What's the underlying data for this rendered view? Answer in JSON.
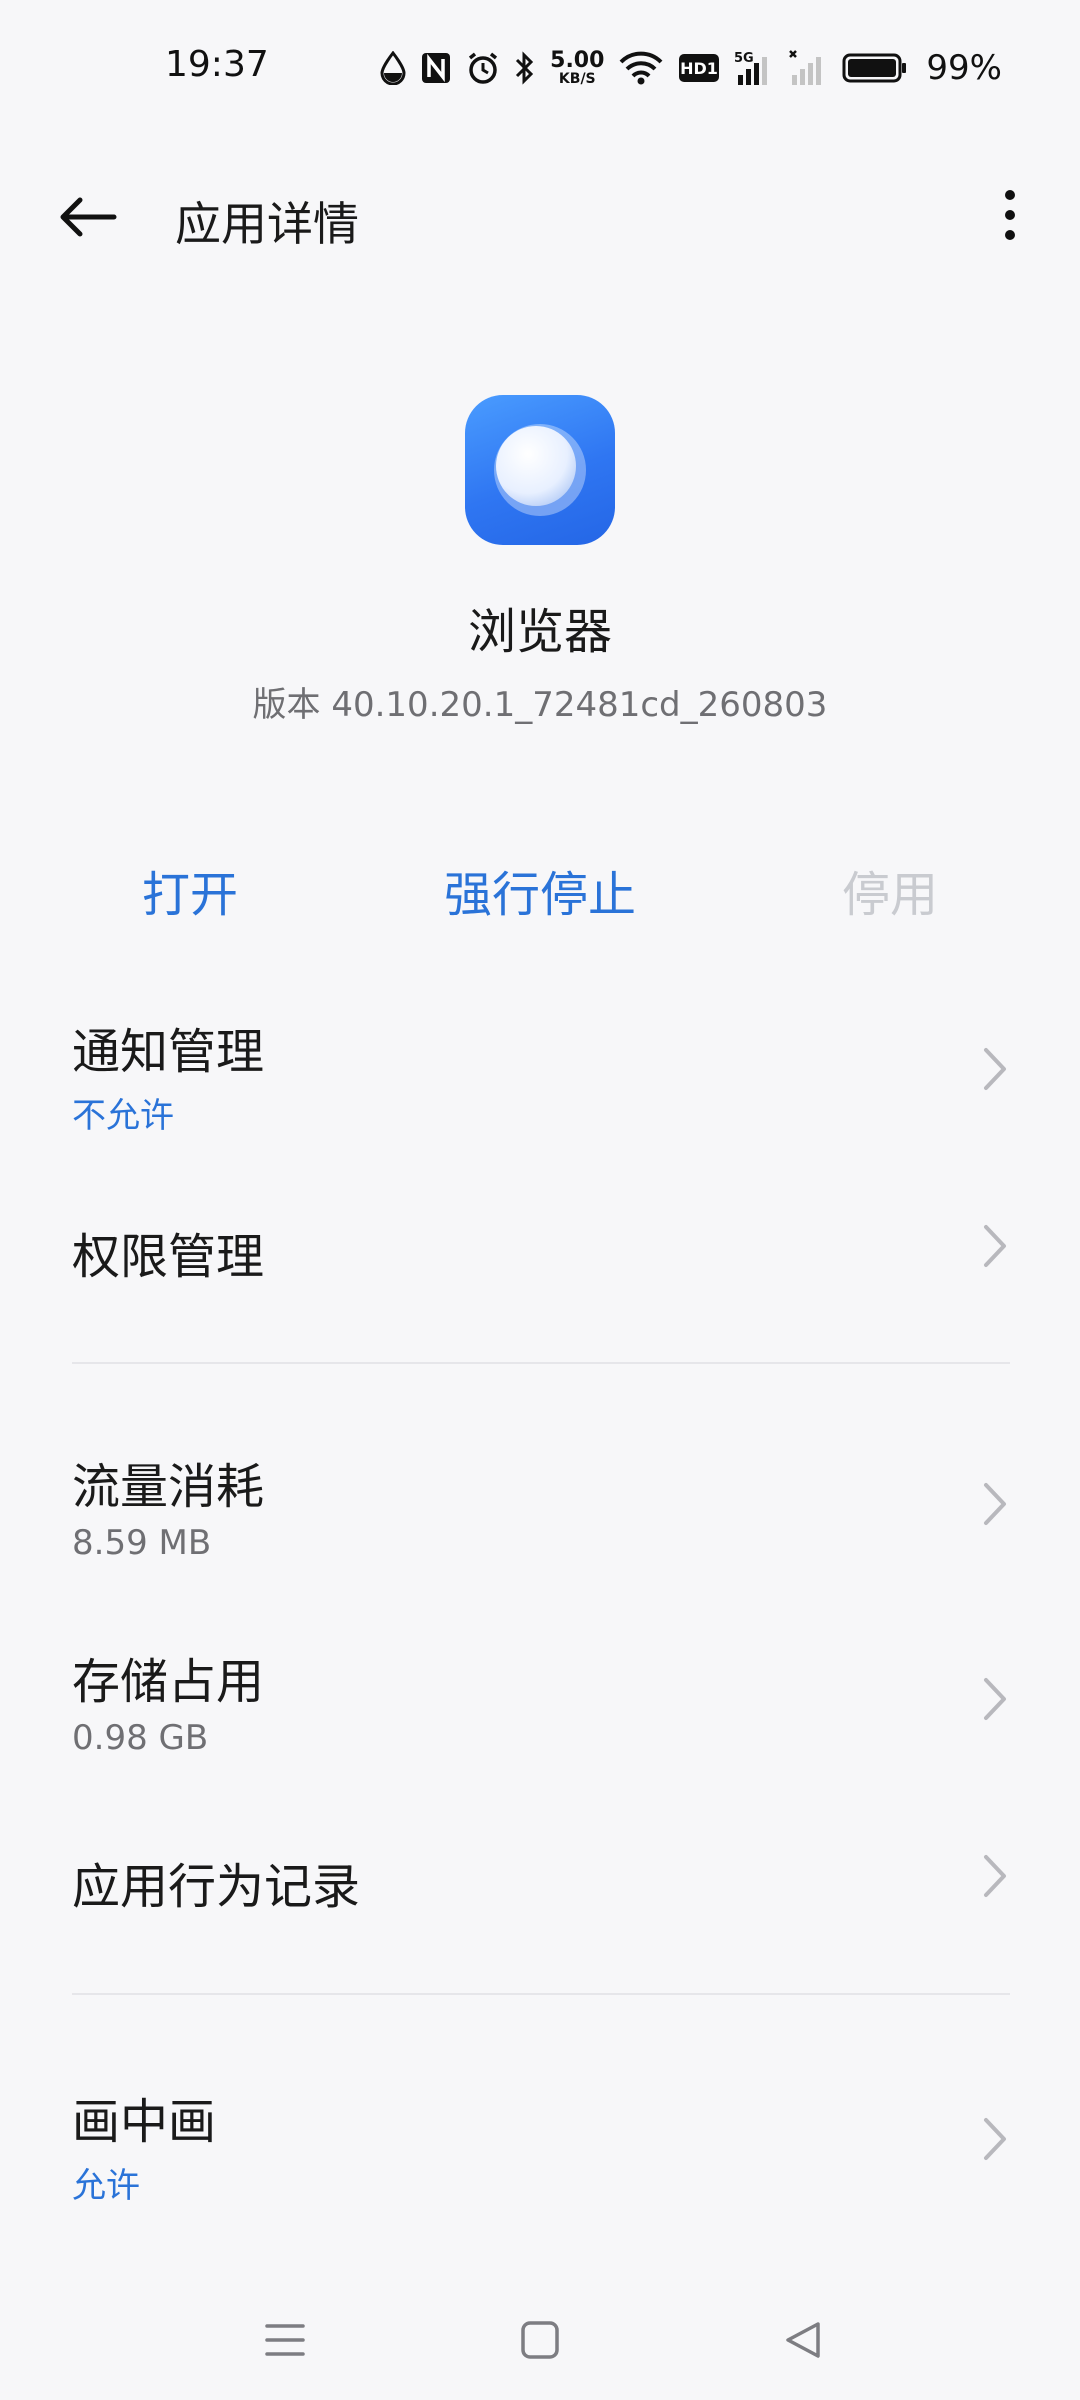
{
  "status_bar": {
    "time": "19:37",
    "network_speed_value": "5.00",
    "network_speed_unit": "KB/S",
    "hd_label": "HD1",
    "network_type": "5G",
    "battery_percent": "99%"
  },
  "app_bar": {
    "title": "应用详情",
    "back_icon": "arrow-left-icon",
    "more_icon": "more-vertical-icon"
  },
  "app": {
    "name": "浏览器",
    "version": "版本 40.10.20.1_72481cd_260803",
    "icon": "browser-app-icon"
  },
  "actions": {
    "open": "打开",
    "force_stop": "强行停止",
    "disable": "停用"
  },
  "list": {
    "notification": {
      "title": "通知管理",
      "value": "不允许"
    },
    "permissions": {
      "title": "权限管理"
    },
    "data_usage": {
      "title": "流量消耗",
      "value": "8.59 MB"
    },
    "storage": {
      "title": "存储占用",
      "value": "0.98 GB"
    },
    "behavior": {
      "title": "应用行为记录"
    },
    "pip": {
      "title": "画中画",
      "value": "允许"
    }
  },
  "colors": {
    "accent": "#2a73d8",
    "disabled": "#c9cbd0",
    "background": "#f7f7f9",
    "secondary_text": "#6f6f73"
  }
}
